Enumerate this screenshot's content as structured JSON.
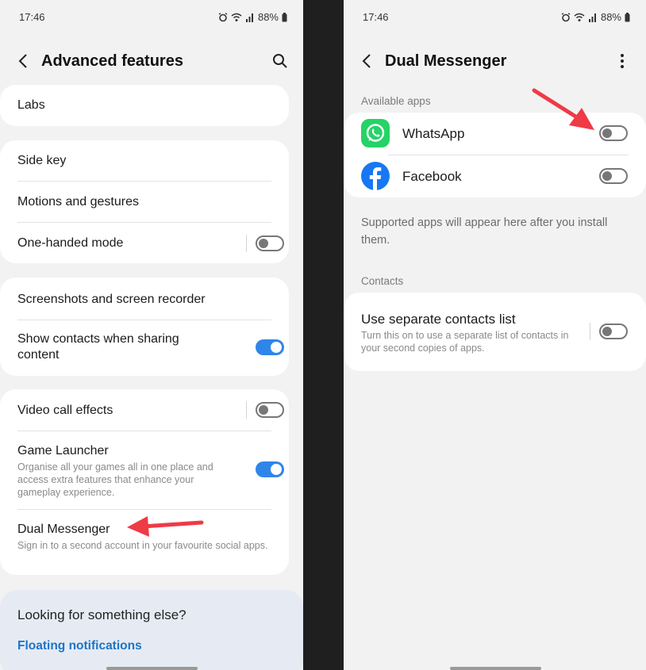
{
  "status": {
    "time": "17:46",
    "battery": "88%"
  },
  "left": {
    "title": "Advanced features",
    "items": {
      "labs": "Labs",
      "side_key": "Side key",
      "motions": "Motions and gestures",
      "one_handed": "One-handed mode",
      "screenshots": "Screenshots and screen recorder",
      "show_contacts": "Show contacts when sharing content",
      "video_call": "Video call effects",
      "game_launcher": "Game Launcher",
      "game_launcher_sub": "Organise all your games all in one place and access extra features that enhance your gameplay experience.",
      "dual_messenger": "Dual Messenger",
      "dual_messenger_sub": "Sign in to a second account in your favourite social apps."
    },
    "toggles": {
      "one_handed": false,
      "show_contacts": true,
      "video_call": false,
      "game_launcher": true
    },
    "suggest": {
      "question": "Looking for something else?",
      "link": "Floating notifications"
    }
  },
  "right": {
    "title": "Dual Messenger",
    "available_apps_header": "Available apps",
    "apps": [
      {
        "name": "WhatsApp",
        "enabled": false,
        "icon": "whatsapp-icon"
      },
      {
        "name": "Facebook",
        "enabled": false,
        "icon": "facebook-icon"
      }
    ],
    "note": "Supported apps will appear here after you install them.",
    "contacts_header": "Contacts",
    "contacts_option": "Use separate contacts list",
    "contacts_sub": "Turn this on to use a separate list of contacts in your second copies of apps.",
    "contacts_enabled": false
  },
  "colors": {
    "accent": "#2f86e8",
    "link": "#1d74c8",
    "arrow": "#ee3b46",
    "whatsapp": "#25d366",
    "facebook": "#1877f2"
  }
}
